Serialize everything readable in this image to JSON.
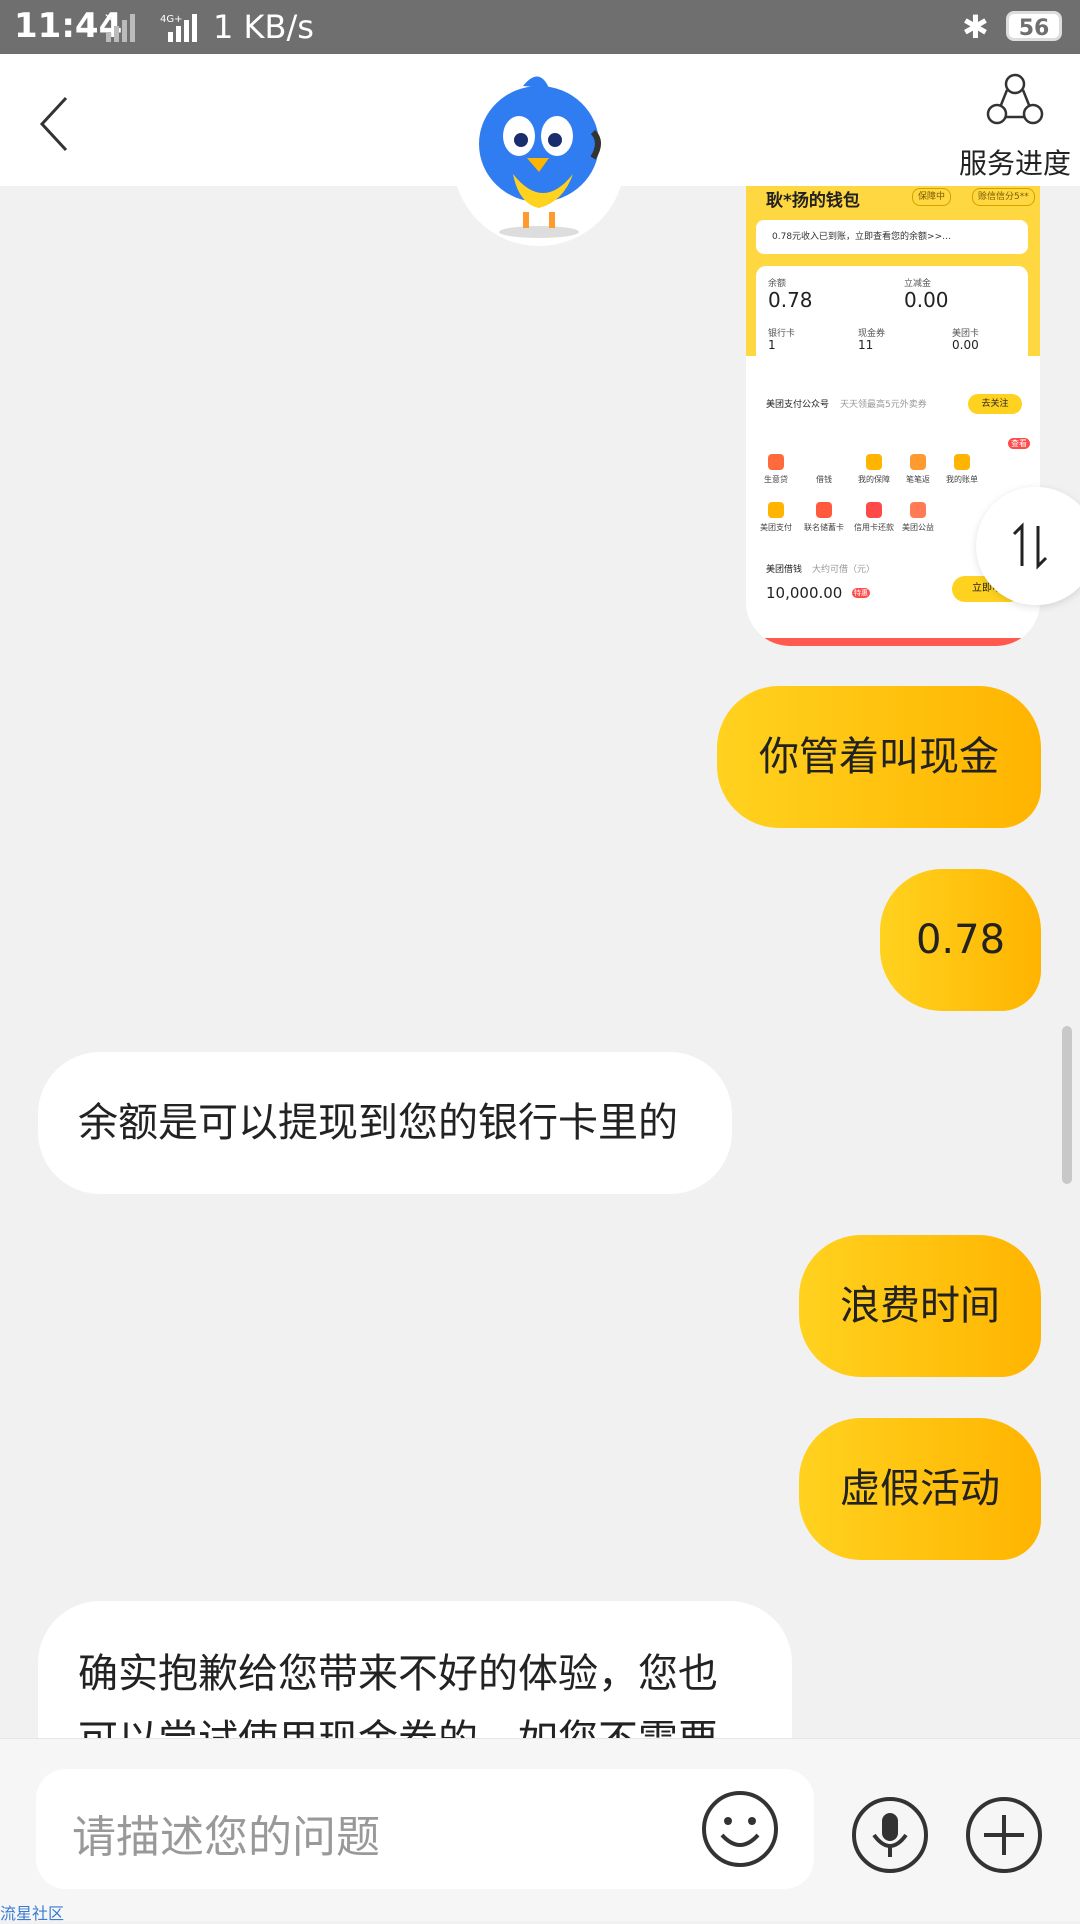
{
  "status_bar": {
    "time": "11:44",
    "network_speed": "1 KB/s",
    "network_type": "4G+",
    "battery": "56"
  },
  "header": {
    "service_progress_label": "服务进度"
  },
  "wallet_card": {
    "title": "耿*扬的钱包",
    "badge_protect": "保障中",
    "badge_credit": "赊信信分5**",
    "notice": "0.78元收入已到账，立即查看您的余额>>…",
    "balance_label": "余额",
    "balance_value": "0.78",
    "discount_label": "立减金",
    "discount_value": "0.00",
    "bank_label": "银行卡",
    "bank_value": "1",
    "coupon_label": "现金券",
    "coupon_value": "11",
    "mtcard_label": "美团卡",
    "mtcard_value": "0.00",
    "promo_text": "美团支付公众号",
    "promo_sub": "天天领最高5元外卖券",
    "promo_button": "去关注",
    "grid": [
      {
        "label": "生意贷",
        "icon": "loan-icon",
        "color": "#ff6a3d"
      },
      {
        "label": "借钱",
        "icon": "cash-icon",
        "color": "#ffffff"
      },
      {
        "label": "我的保障",
        "icon": "shield-icon",
        "color": "#ffb400"
      },
      {
        "label": "笔笔返",
        "icon": "rebate-icon",
        "color": "#ff9a2e"
      },
      {
        "label": "我的账单",
        "icon": "bill-icon",
        "color": "#ffb400"
      },
      {
        "label": "美团支付",
        "icon": "pay-icon",
        "color": "#ffb400"
      },
      {
        "label": "联名储蓄卡",
        "icon": "card-icon",
        "color": "#ff5a3d"
      },
      {
        "label": "信用卡还款",
        "icon": "credit-icon",
        "color": "#ff4a4a"
      },
      {
        "label": "美团公益",
        "icon": "heart-icon",
        "color": "#ff7a55"
      }
    ],
    "grid_badge": "查看",
    "loan_title": "美团借钱",
    "loan_sub": "大约可借（元）",
    "loan_amount": "10,000.00",
    "loan_tag": "特惠",
    "loan_button": "立即申"
  },
  "messages": [
    {
      "dir": "out",
      "text": "你管着叫现金"
    },
    {
      "dir": "out",
      "text": "0.78"
    },
    {
      "dir": "in",
      "text": "余额是可以提现到您的银行卡里的"
    },
    {
      "dir": "out",
      "text": "浪费时间"
    },
    {
      "dir": "out",
      "text": "虚假活动"
    },
    {
      "dir": "in",
      "text_line1": "确实抱歉给您带来不好的体验，您也",
      "text_line2": "可以尝试使用现金券的，如您不需要"
    }
  ],
  "input": {
    "placeholder": "请描述您的问题"
  },
  "watermark": "流星社区"
}
